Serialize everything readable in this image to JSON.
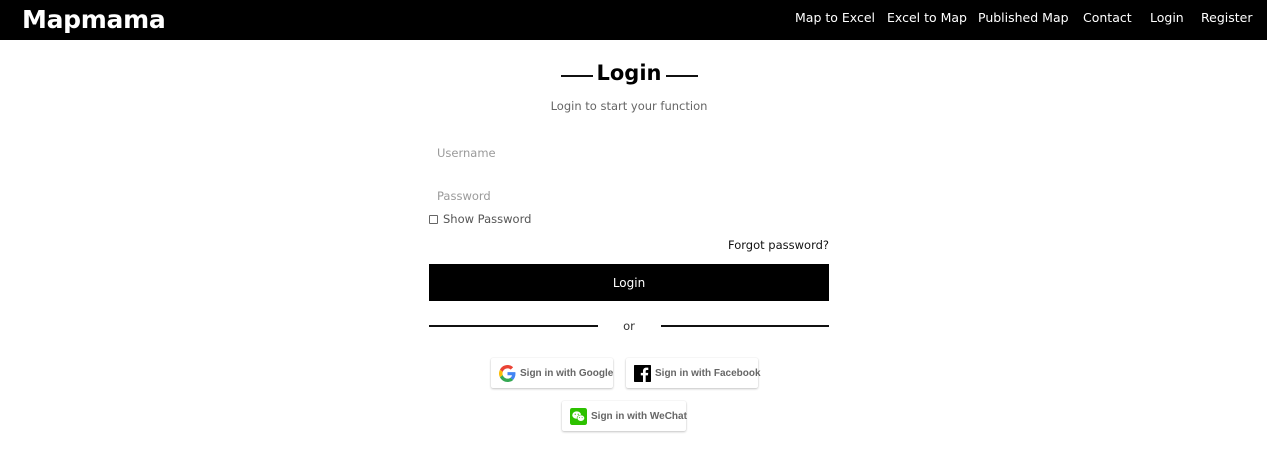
{
  "header": {
    "brand": "Mapmama",
    "nav": [
      {
        "label": "Map to Excel"
      },
      {
        "label": "Excel to Map"
      },
      {
        "label": "Published Map"
      },
      {
        "label": "Contact"
      },
      {
        "label": "Login"
      },
      {
        "label": "Register"
      }
    ]
  },
  "login": {
    "title": "Login",
    "subtitle": "Login to start your function",
    "username_placeholder": "Username",
    "password_placeholder": "Password",
    "show_password_label": "Show Password",
    "forgot_password": "Forgot password?",
    "login_button": "Login",
    "divider_text": "or"
  },
  "social": {
    "google_label": "Sign in with Google",
    "facebook_label": "Sign in with Facebook",
    "wechat_label": "Sign in with WeChat",
    "google_icon": "google-icon",
    "facebook_icon": "facebook-icon",
    "wechat_icon": "wechat-icon"
  },
  "colors": {
    "header_bg": "#000000",
    "button_bg": "#000000",
    "facebook": "#000000",
    "wechat": "#2dc100"
  }
}
